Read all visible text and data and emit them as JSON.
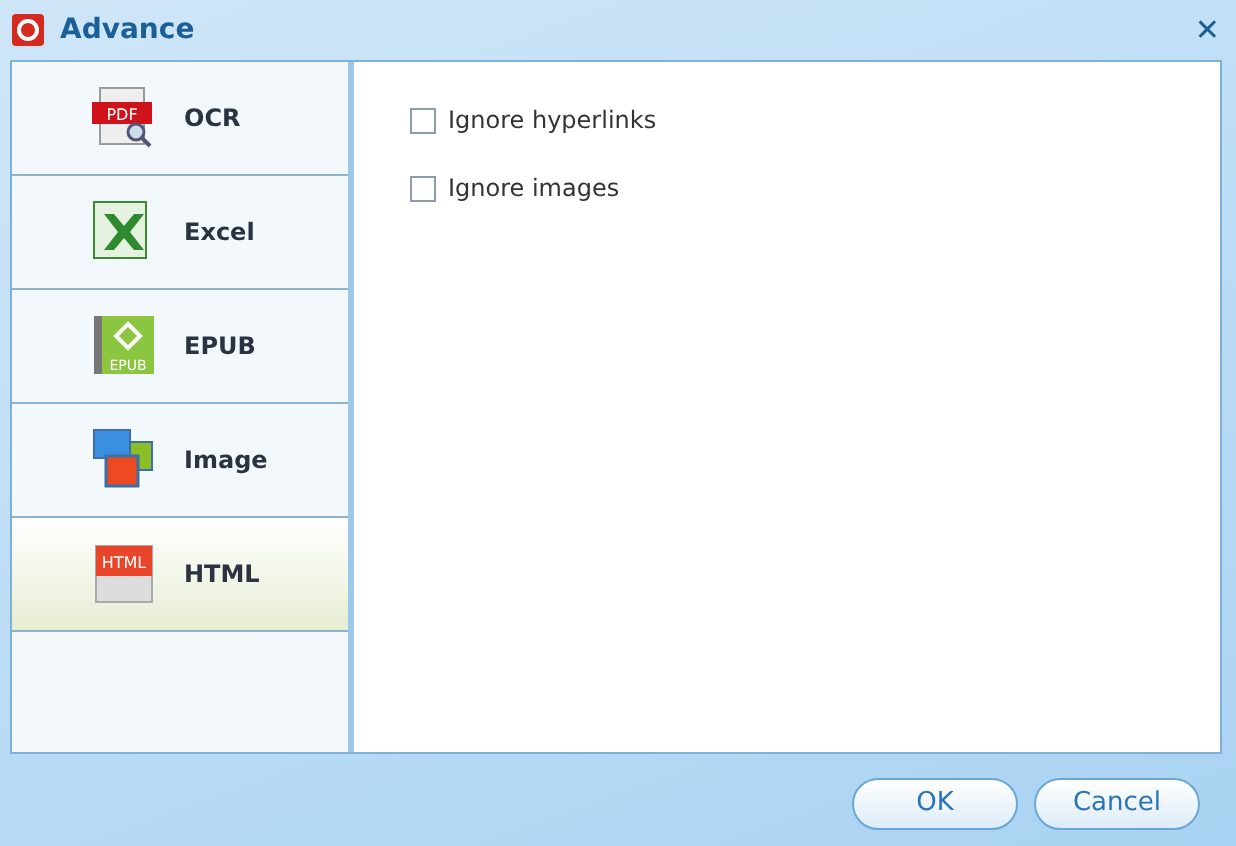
{
  "window": {
    "title": "Advance",
    "close": "✕"
  },
  "sidebar": {
    "items": [
      {
        "kind": "ocr",
        "label": "OCR",
        "icon_text": "PDF",
        "selected": false
      },
      {
        "kind": "excel",
        "label": "Excel",
        "selected": false
      },
      {
        "kind": "epub",
        "label": "EPUB",
        "icon_text": "EPUB",
        "selected": false
      },
      {
        "kind": "image",
        "label": "Image",
        "selected": false
      },
      {
        "kind": "html",
        "label": "HTML",
        "icon_text": "HTML",
        "selected": true
      }
    ]
  },
  "options": [
    {
      "label": "Ignore hyperlinks",
      "checked": false
    },
    {
      "label": "Ignore images",
      "checked": false
    }
  ],
  "buttons": [
    "OK",
    "Cancel"
  ]
}
